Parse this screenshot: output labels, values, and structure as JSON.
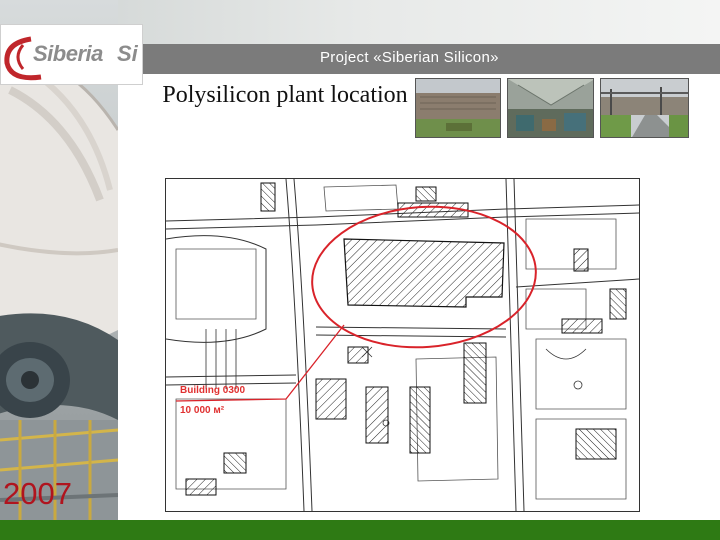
{
  "header": {
    "logo_text": "Siberia",
    "logo_suffix": "Si",
    "project_title": "Project «Siberian Silicon»"
  },
  "slide": {
    "title": "Polysilicon plant location",
    "year": "2007"
  },
  "photos": [
    {
      "name": "plant-exterior-photo"
    },
    {
      "name": "workshop-interior-photo"
    },
    {
      "name": "site-road-photo"
    }
  ],
  "map": {
    "annotation_building": "Building 0300",
    "annotation_area": "10 000 м²",
    "highlight_color": "#d9232a",
    "annotation_color": "#e03030"
  },
  "colors": {
    "header_bar": "#7b7b7b",
    "footer_bar": "#2e7a14",
    "year_text": "#b0141e"
  }
}
